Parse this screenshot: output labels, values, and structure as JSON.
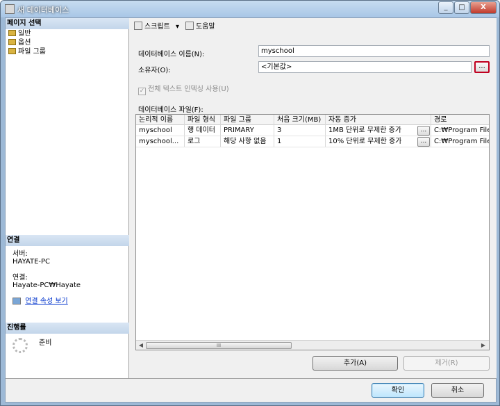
{
  "window": {
    "title": "새 데이터베이스",
    "controls": [
      "_",
      "□",
      "X"
    ]
  },
  "left": {
    "select_page_header": "페이지 선택",
    "pages": [
      {
        "label": "일반",
        "icon": "page-icon"
      },
      {
        "label": "옵션",
        "icon": "page-icon"
      },
      {
        "label": "파일 그룹",
        "icon": "page-icon"
      }
    ],
    "connection_header": "연결",
    "server_label": "서버:",
    "server_value": "HAYATE-PC",
    "connection_label": "연결:",
    "connection_value": "Hayate-PC₩Hayate",
    "view_props_link": "연결 속성 보기",
    "progress_header": "진행률",
    "progress_status": "준비"
  },
  "toolbar": {
    "script_label": "스크립트",
    "help_label": "도움말"
  },
  "form": {
    "db_name_label": "데이터베이스 이름(N):",
    "db_name_value": "myschool",
    "owner_label": "소유자(O):",
    "owner_value": "<기본값>",
    "ellipsis": "...",
    "fulltext_label": "전체 텍스트 인덱싱 사용(U)",
    "files_label": "데이터베이스 파일(F):"
  },
  "grid": {
    "columns": [
      "논리적 이름",
      "파일 형식",
      "파일 그룹",
      "처음 크기(MB)",
      "자동 증가",
      "경로"
    ],
    "rows": [
      {
        "logical": "myschool",
        "type": "행 데이터",
        "group": "PRIMARY",
        "size": "3",
        "growth": "1MB 단위로 무제한 증가",
        "path": "C:₩Program Files"
      },
      {
        "logical": "myschool...",
        "type": "로그",
        "group": "해당 사항 없음",
        "size": "1",
        "growth": "10% 단위로 무제한 증가",
        "path": "C:₩Program Files"
      }
    ],
    "row_button": "...",
    "scroll_left": "◀",
    "scroll_right": "▶",
    "scroll_grip": "III"
  },
  "buttons": {
    "add": "추가(A)",
    "remove": "제거(R)",
    "ok": "확인",
    "cancel": "취소"
  },
  "colors": {
    "highlight_border": "#c00020",
    "link": "#0033cc"
  }
}
